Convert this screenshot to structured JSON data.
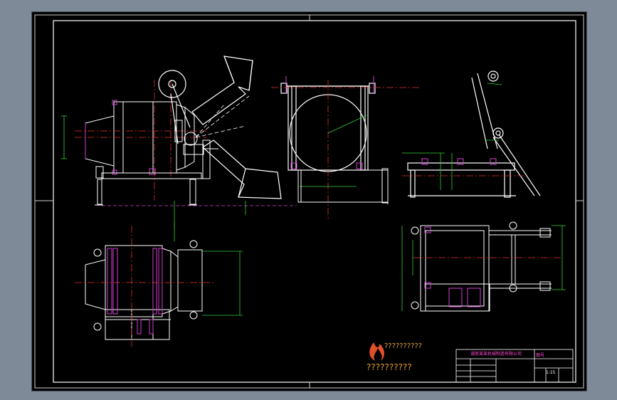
{
  "watermark": {
    "brand_line": "??????????",
    "sub_line": "??????????",
    "sub_line_color": "#e09a2c",
    "logo_color": "#e0502c"
  },
  "title_block": {
    "company": "湖南某某机械制造有限公司",
    "drawing_no": "图号",
    "scale": "1:15"
  },
  "colors": {
    "outline": "#ffffff",
    "centerline": "#e03030",
    "dimension": "#34d134",
    "hidden": "#d040d0"
  }
}
